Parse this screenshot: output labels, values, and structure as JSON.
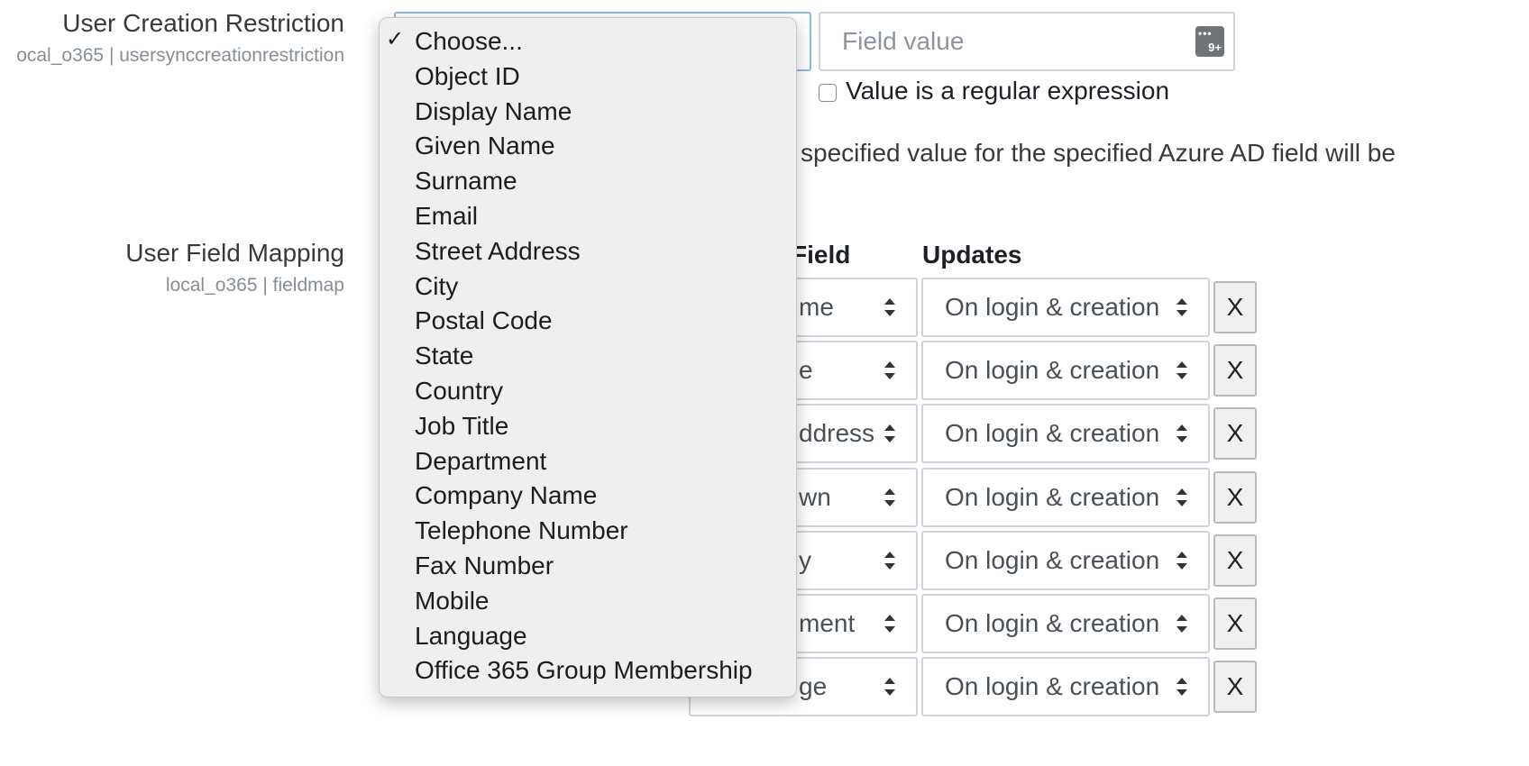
{
  "restriction": {
    "title": "User Creation Restriction",
    "subtitle": "ocal_o365 | usersynccreationrestriction",
    "field_value_placeholder": "Field value",
    "icon_badge": "9+",
    "icon_dots": "•••",
    "regex_label": "Value is a regular expression",
    "description_visible": "specified value for the specified Azure AD field will be"
  },
  "fieldmap": {
    "title": "User Field Mapping",
    "subtitle": "local_o365 | fieldmap",
    "column_header_partial": "Field",
    "column_header_updates": "Updates",
    "rows": [
      {
        "moodle_field_partial": "me",
        "updates": "On login & creation",
        "remove": "X"
      },
      {
        "moodle_field_partial": "e",
        "updates": "On login & creation",
        "remove": "X"
      },
      {
        "moodle_field_partial": "ddress",
        "updates": "On login & creation",
        "remove": "X"
      },
      {
        "moodle_field_partial": "wn",
        "updates": "On login & creation",
        "remove": "X"
      },
      {
        "moodle_field_partial": "y",
        "updates": "On login & creation",
        "remove": "X"
      },
      {
        "moodle_field_partial": "ment",
        "updates": "On login & creation",
        "remove": "X"
      },
      {
        "moodle_field_partial": "ge",
        "updates": "On login & creation",
        "remove": "X"
      }
    ]
  },
  "dropdown": {
    "selected": "Choose...",
    "checkmark": "✓",
    "options": [
      "Choose...",
      "Object ID",
      "Display Name",
      "Given Name",
      "Surname",
      "Email",
      "Street Address",
      "City",
      "Postal Code",
      "State",
      "Country",
      "Job Title",
      "Department",
      "Company Name",
      "Telephone Number",
      "Fax Number",
      "Mobile",
      "Language",
      "Office 365 Group Membership"
    ]
  }
}
